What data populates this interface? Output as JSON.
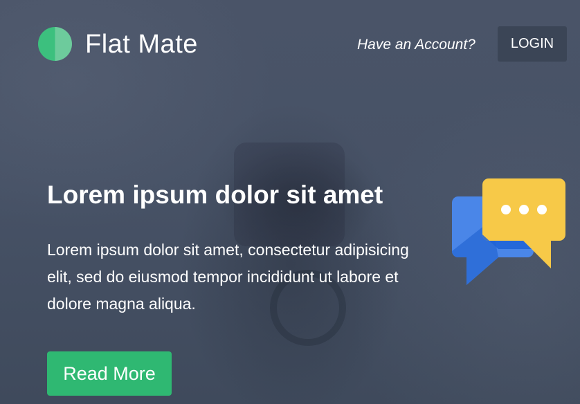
{
  "header": {
    "brand_name": "Flat Mate",
    "account_prompt": "Have an Account?",
    "login_label": "LOGIN"
  },
  "hero": {
    "headline": "Lorem ipsum dolor sit amet",
    "body": "Lorem ipsum dolor sit amet, consectetur adipisicing elit, sed do eiusmod tempor incididunt ut labore et dolore magna aliqua.",
    "cta_label": "Read More"
  },
  "icons": {
    "logo": "half-circle-logo-icon",
    "illustration": "chat-bubbles-icon"
  },
  "colors": {
    "accent_green": "#2fb872",
    "logo_green_dark": "#3cc07e",
    "logo_green_light": "#6dcb9c",
    "bubble_blue": "#4a86e8",
    "bubble_blue_dark": "#2f6fd9",
    "bubble_yellow": "#f7c948",
    "login_bg": "#3b4556",
    "background": "#4a5468"
  }
}
